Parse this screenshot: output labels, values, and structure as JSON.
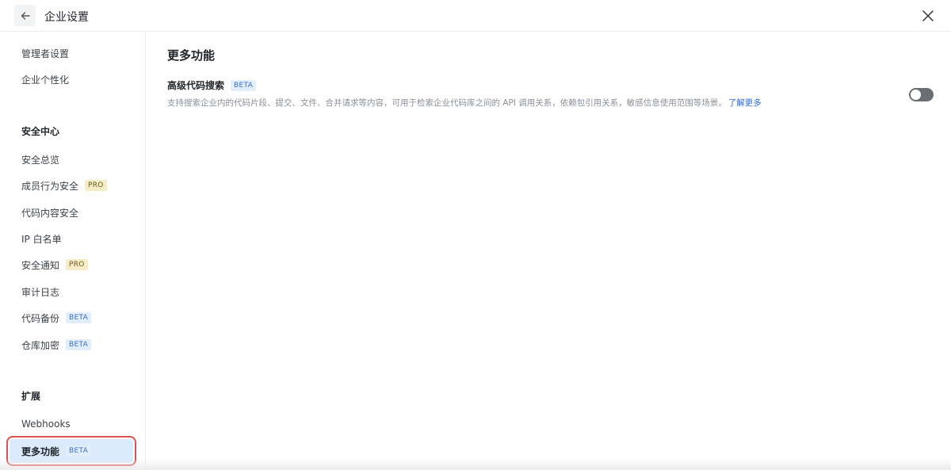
{
  "header": {
    "title": "企业设置",
    "back_icon": "arrow-left-icon",
    "close_icon": "close-icon"
  },
  "sidebar": {
    "items_top": [
      {
        "label": "管理者设置"
      },
      {
        "label": "企业个性化"
      }
    ],
    "security": {
      "title": "安全中心",
      "items": [
        {
          "label": "安全总览",
          "tag": ""
        },
        {
          "label": "成员行为安全",
          "tag": "PRO"
        },
        {
          "label": "代码内容安全",
          "tag": ""
        },
        {
          "label": "IP 白名单",
          "tag": ""
        },
        {
          "label": "安全通知",
          "tag": "PRO"
        },
        {
          "label": "审计日志",
          "tag": ""
        },
        {
          "label": "代码备份",
          "tag": "BETA"
        },
        {
          "label": "仓库加密",
          "tag": "BETA"
        }
      ]
    },
    "extensions": {
      "title": "扩展",
      "items": [
        {
          "label": "Webhooks",
          "tag": ""
        },
        {
          "label": "更多功能",
          "tag": "BETA",
          "active": true
        }
      ]
    }
  },
  "main": {
    "title": "更多功能",
    "feature": {
      "name": "高级代码搜索",
      "tag": "BETA",
      "description": "支持搜索企业内的代码片段、提交、文件、合并请求等内容，可用于检索企业代码库之间的 API 调用关系，依赖包引用关系，敏感信息使用范围等场景。",
      "link": "了解更多",
      "enabled": false
    }
  },
  "colors": {
    "accent": "#2f6fd6",
    "active_bg": "#dbeafc",
    "highlight_outline": "#d9534f",
    "toggle_off": "#6b6e73"
  }
}
